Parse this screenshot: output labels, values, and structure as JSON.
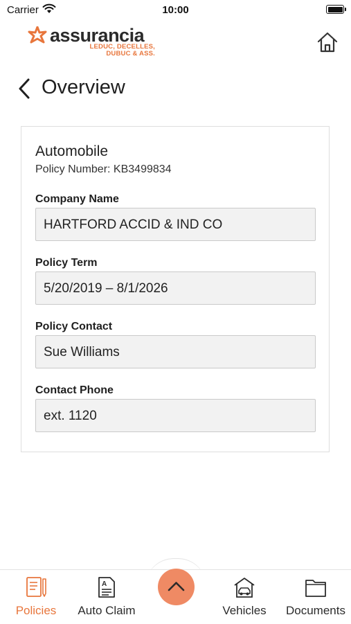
{
  "status_bar": {
    "carrier": "Carrier",
    "time": "10:00"
  },
  "header": {
    "logo_word": "assurancia",
    "logo_sub_line1": "LEDUC, DECELLES,",
    "logo_sub_line2": "DUBUC & ASS.",
    "home_icon": "home-icon"
  },
  "page": {
    "title": "Overview",
    "back_icon": "chevron-left-icon"
  },
  "policy": {
    "type": "Automobile",
    "number_line": "Policy Number: KB3499834",
    "fields": [
      {
        "label": "Company Name",
        "value": "HARTFORD ACCID & IND CO"
      },
      {
        "label": "Policy Term",
        "value": "5/20/2019 – 8/1/2026"
      },
      {
        "label": "Policy Contact",
        "value": "Sue Williams"
      },
      {
        "label": "Contact Phone",
        "value": "ext. 1120"
      }
    ]
  },
  "tab_bar": {
    "tabs": [
      {
        "label": "Policies",
        "icon": "policies-icon",
        "active": true
      },
      {
        "label": "Auto Claim",
        "icon": "auto-claim-icon",
        "active": false
      },
      {
        "label": "Vehicles",
        "icon": "vehicles-icon",
        "active": false
      },
      {
        "label": "Documents",
        "icon": "documents-icon",
        "active": false
      }
    ],
    "center_button_icon": "chevron-up-icon"
  },
  "colors": {
    "accent": "#e8763c",
    "fab": "#ef8a64",
    "field_bg": "#f2f2f2"
  }
}
